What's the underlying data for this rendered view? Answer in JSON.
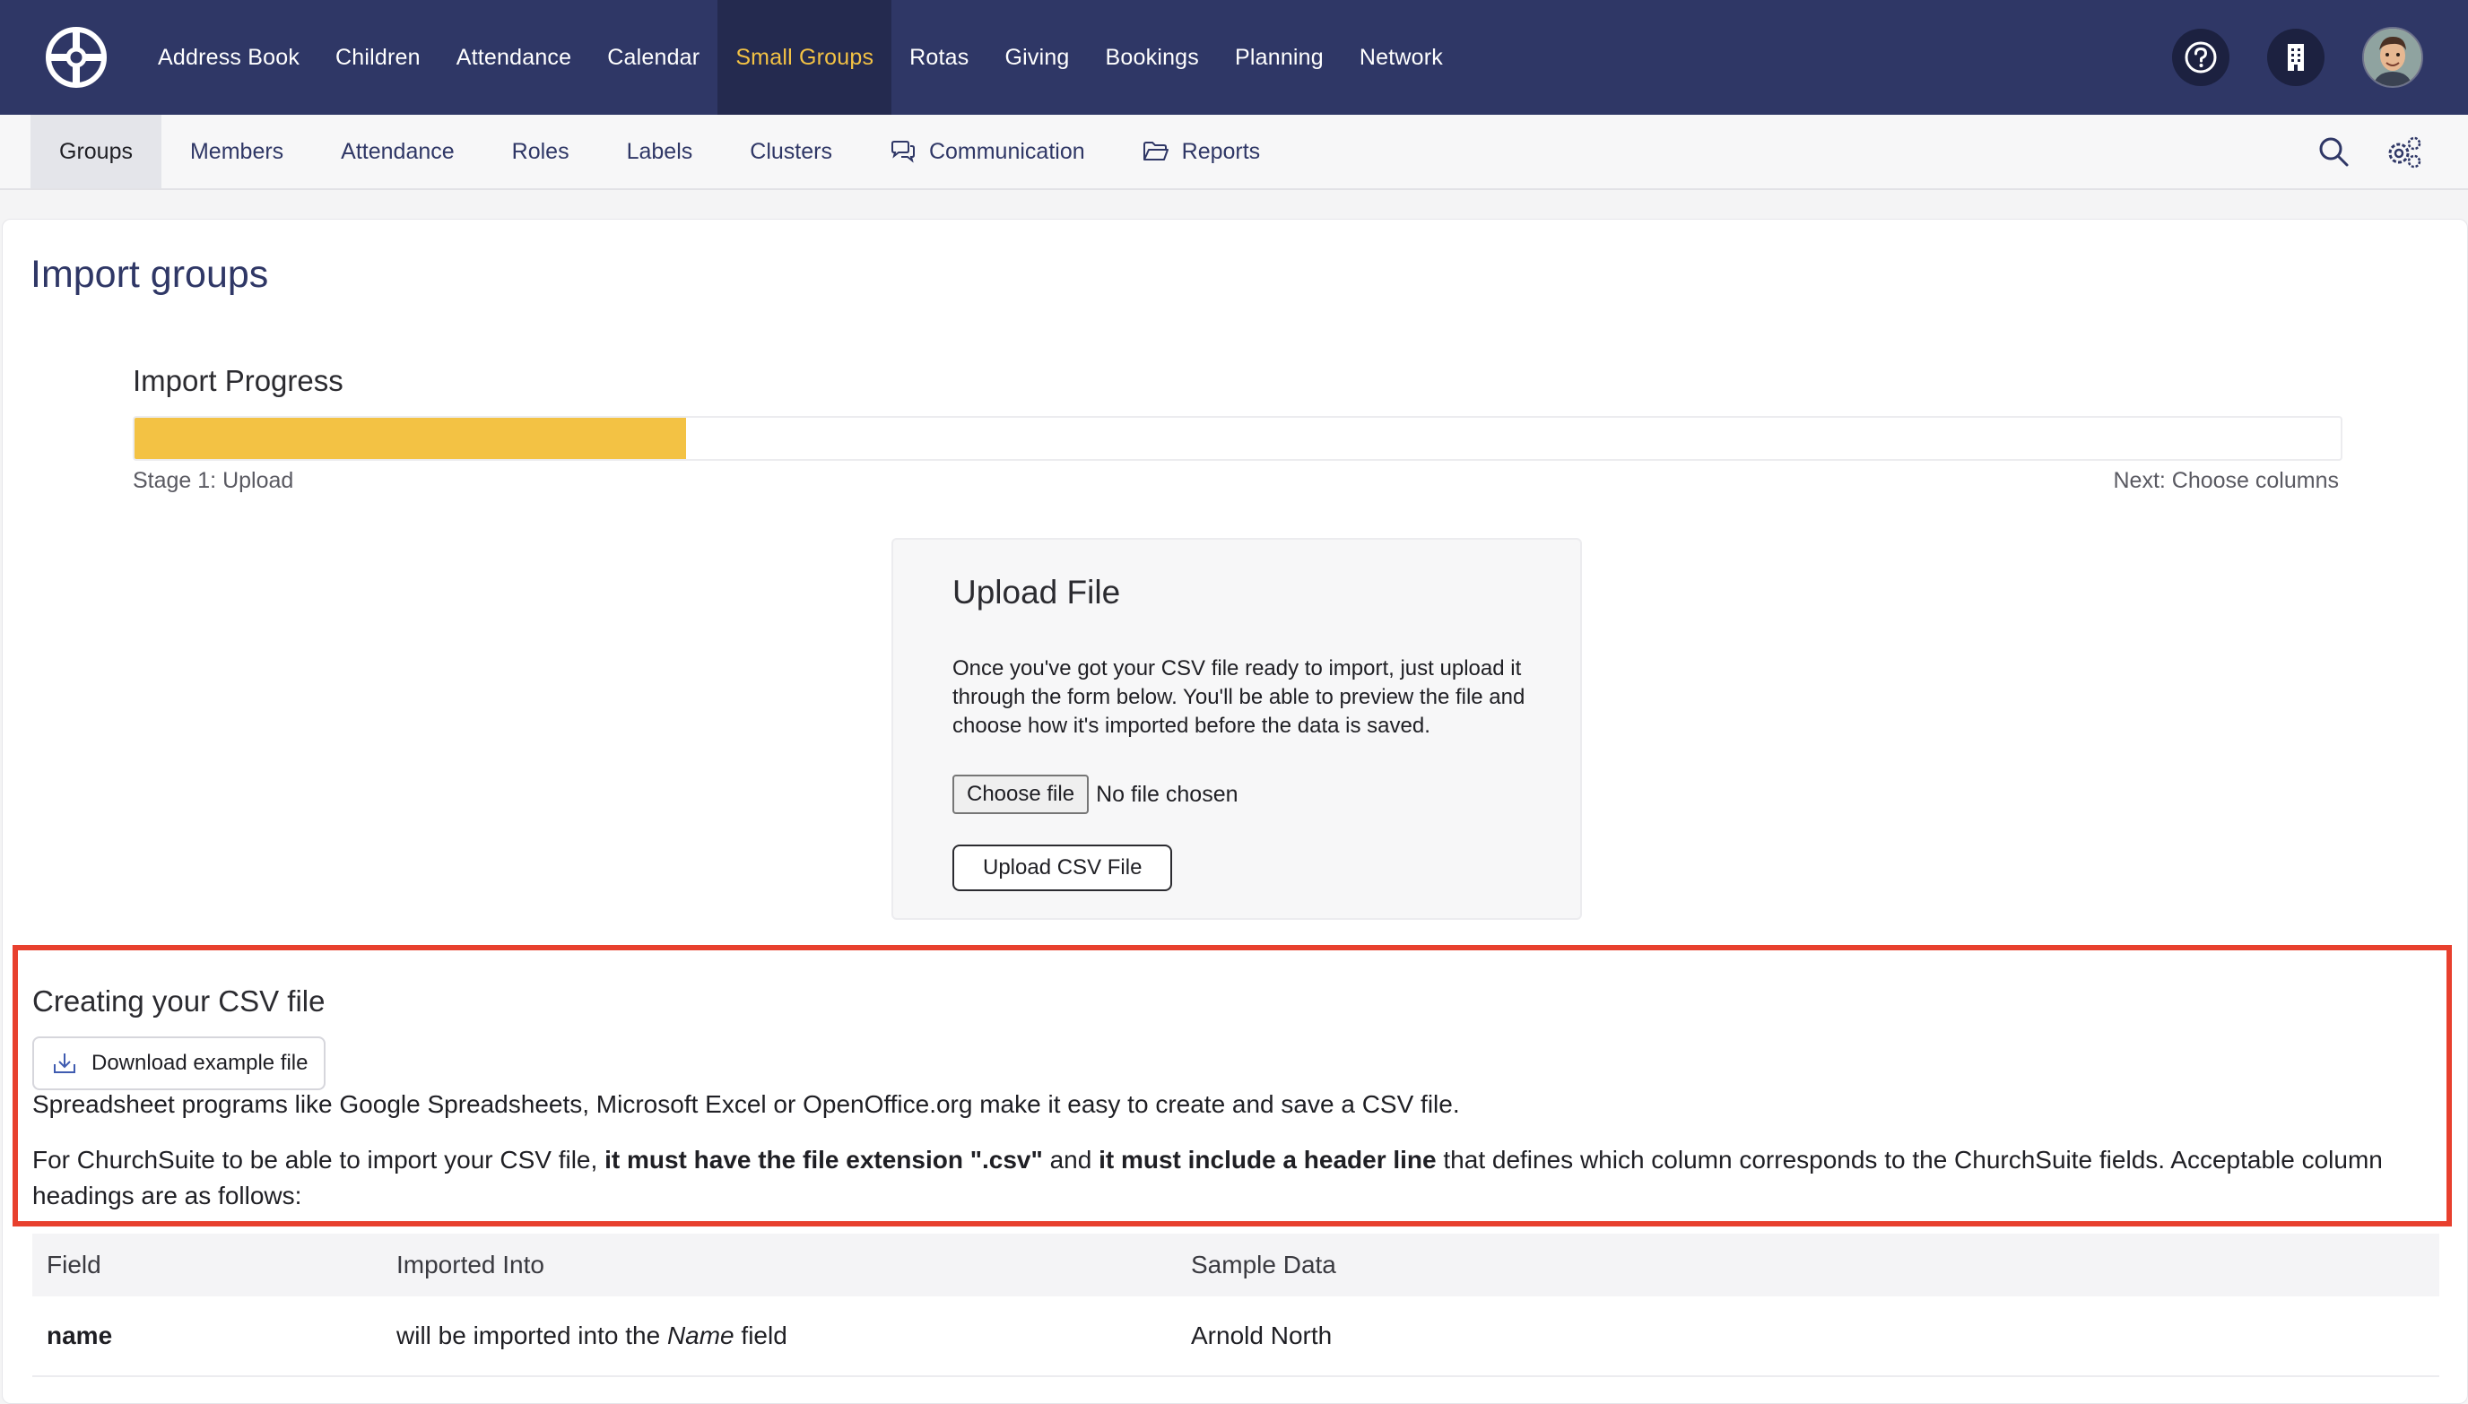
{
  "topnav": {
    "items": [
      {
        "label": "Address Book"
      },
      {
        "label": "Children"
      },
      {
        "label": "Attendance"
      },
      {
        "label": "Calendar"
      },
      {
        "label": "Small Groups"
      },
      {
        "label": "Rotas"
      },
      {
        "label": "Giving"
      },
      {
        "label": "Bookings"
      },
      {
        "label": "Planning"
      },
      {
        "label": "Network"
      }
    ],
    "active": "Small Groups",
    "icons": [
      "help-icon",
      "building-icon",
      "avatar"
    ]
  },
  "subnav": {
    "items": [
      {
        "label": "Groups"
      },
      {
        "label": "Members"
      },
      {
        "label": "Attendance"
      },
      {
        "label": "Roles"
      },
      {
        "label": "Labels"
      },
      {
        "label": "Clusters"
      },
      {
        "label": "Communication",
        "icon": "chat-icon"
      },
      {
        "label": "Reports",
        "icon": "folder-icon"
      }
    ],
    "active": "Groups"
  },
  "page": {
    "title": "Import groups"
  },
  "progress": {
    "label": "Import Progress",
    "fraction": 0.25,
    "stage": "Stage 1: Upload",
    "next": "Next: Choose columns"
  },
  "upload": {
    "title": "Upload File",
    "description": "Once you've got your CSV file ready to import, just upload it through the form below. You'll be able to preview the file and choose how it's imported before the data is saved.",
    "choose_label": "Choose file",
    "no_file": "No file chosen",
    "upload_label": "Upload CSV File"
  },
  "csv": {
    "title": "Creating your CSV file",
    "download_label": "Download example file",
    "para1": "Spreadsheet programs like Google Spreadsheets, Microsoft Excel or OpenOffice.org make it easy to create and save a CSV file.",
    "para2_a": "For ChurchSuite to be able to import your CSV file,",
    "para2_b": "it must have the file extension \".csv\"",
    "para2_c": "and",
    "para2_d": "it must include a header line",
    "para2_e": "that defines which column corresponds to the ChurchSuite fields. Acceptable column headings are as follows:"
  },
  "table": {
    "headers": {
      "field": "Field",
      "imported": "Imported Into",
      "sample": "Sample Data"
    },
    "rows": [
      {
        "field": "name",
        "imported_pre": "will be imported into the",
        "imported_field": "Name",
        "imported_post": "field",
        "sample": "Arnold North"
      }
    ]
  },
  "colors": {
    "brand": "#2f3766",
    "accent": "#f3c244",
    "highlight": "#e8402e"
  }
}
